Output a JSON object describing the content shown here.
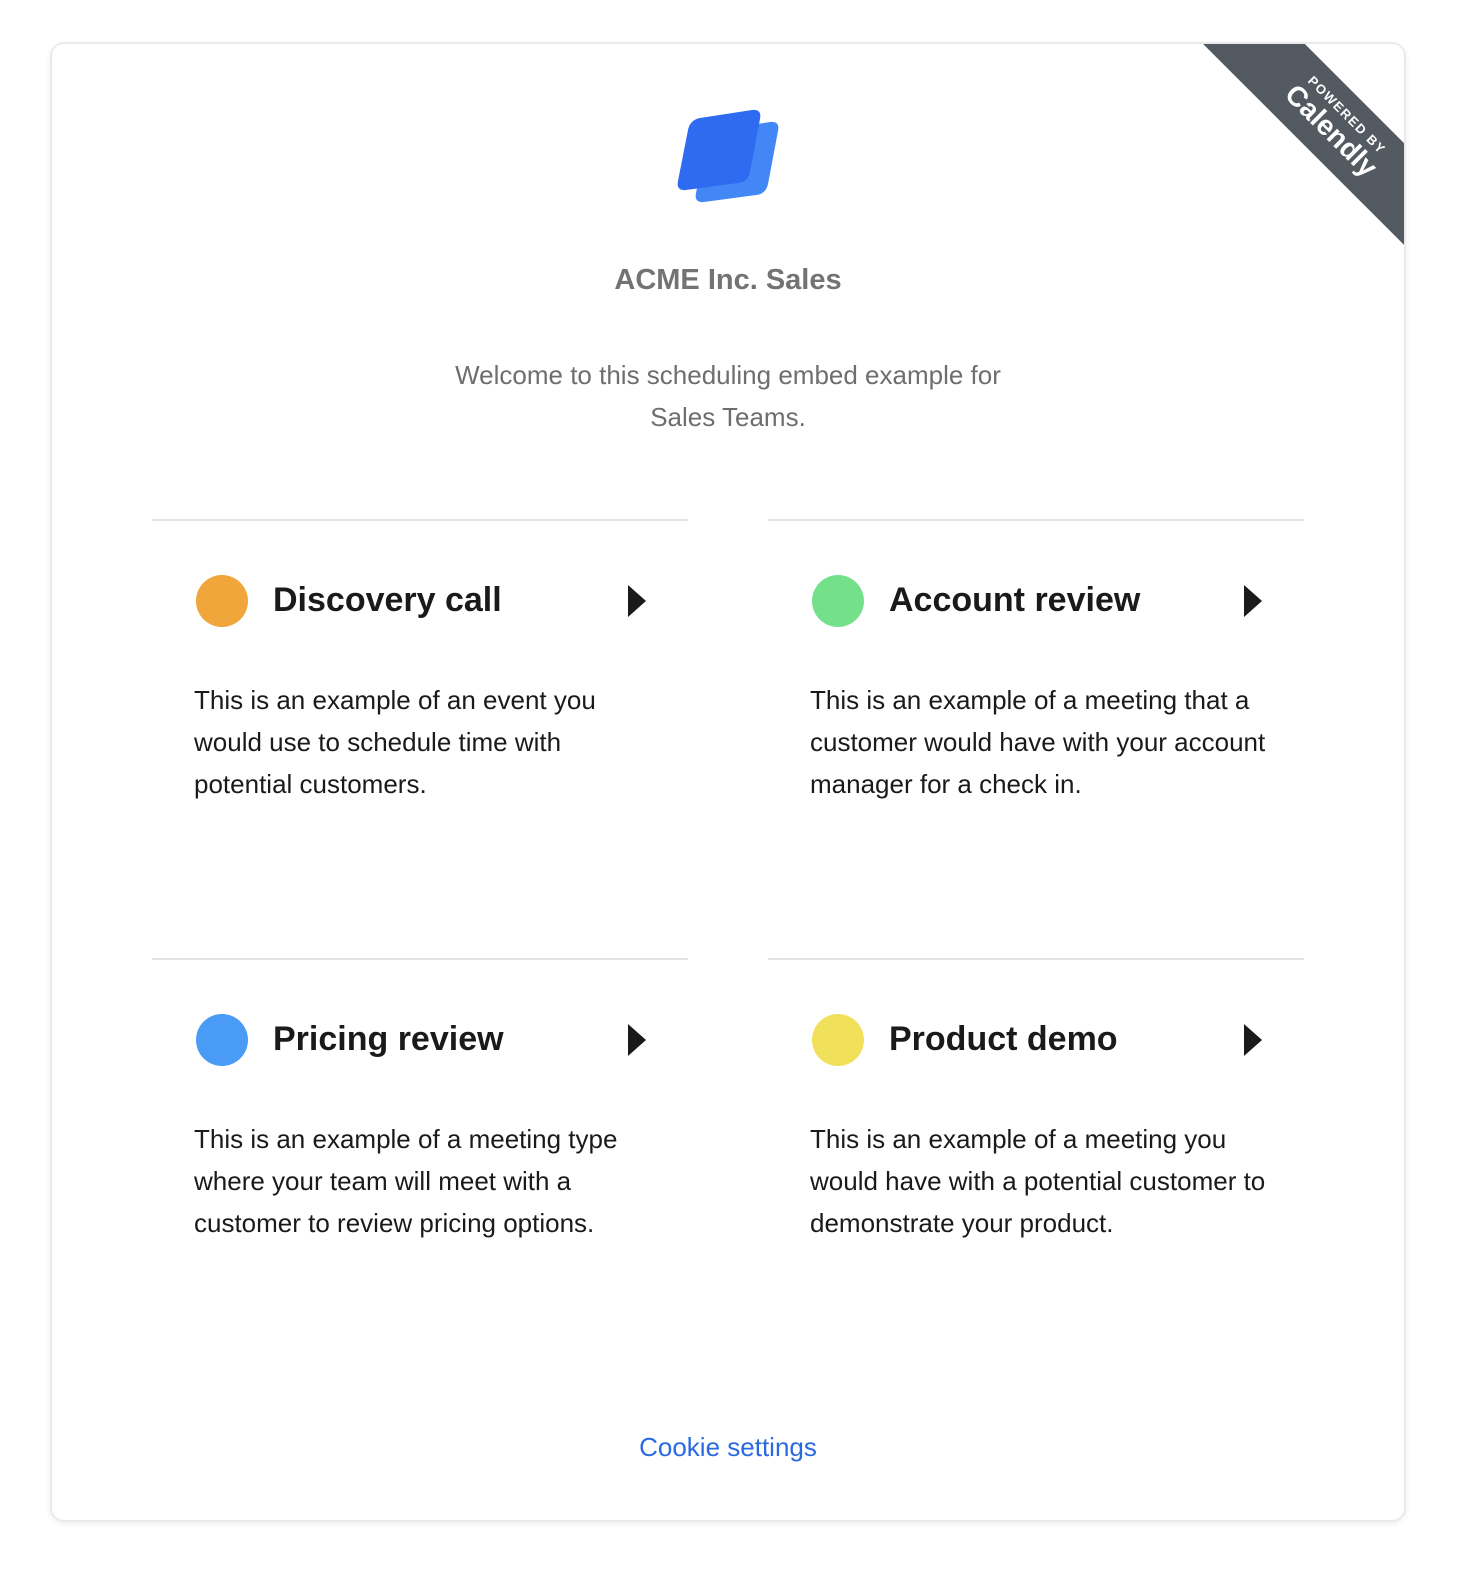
{
  "ribbon": {
    "small_text": "POWERED BY",
    "brand_text": "Calendly",
    "color": "#545a61"
  },
  "header": {
    "company_name": "ACME Inc. Sales",
    "welcome_text": "Welcome to this scheduling embed example for Sales Teams."
  },
  "events": [
    {
      "title": "Discovery call",
      "description": "This is an example of an event you would use to schedule time with potential customers.",
      "color": "#f0a63a"
    },
    {
      "title": "Account review",
      "description": "This is an example of a meeting that a customer would have with your account manager for a check in.",
      "color": "#74e08a"
    },
    {
      "title": "Pricing review",
      "description": "This is an example of a meeting type where your team will meet with a customer to review pricing options.",
      "color": "#4a9bf5"
    },
    {
      "title": "Product demo",
      "description": "This is an example of a meeting you would have with a potential customer to demonstrate your product.",
      "color": "#f0e05a"
    }
  ],
  "footer": {
    "cookie_settings": "Cookie settings",
    "link_color": "#2a6ae0"
  }
}
